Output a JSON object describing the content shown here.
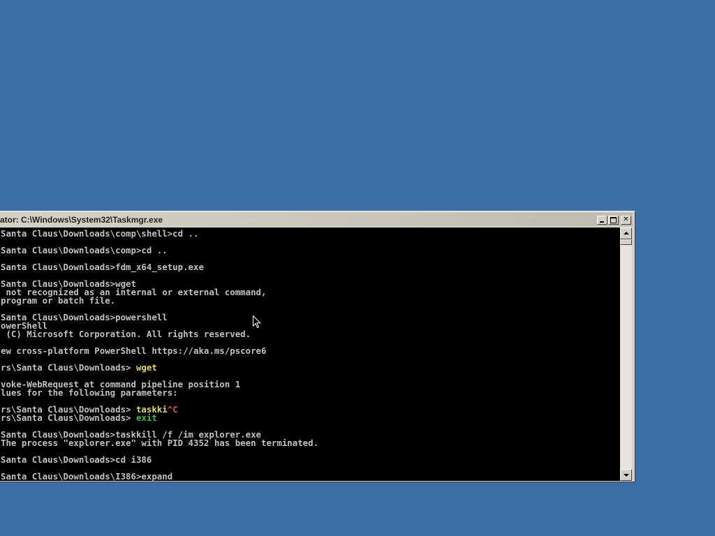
{
  "window": {
    "title": "ator: C:\\Windows\\System32\\Taskmgr.exe"
  },
  "console": {
    "lines": [
      [
        {
          "t": "Santa Claus\\Downloads\\comp\\shell>cd ..",
          "c": ""
        }
      ],
      [
        {
          "t": "",
          "c": ""
        }
      ],
      [
        {
          "t": "Santa Claus\\Downloads\\comp>cd ..",
          "c": ""
        }
      ],
      [
        {
          "t": "",
          "c": ""
        }
      ],
      [
        {
          "t": "Santa Claus\\Downloads>fdm_x64_setup.exe",
          "c": ""
        }
      ],
      [
        {
          "t": "",
          "c": ""
        }
      ],
      [
        {
          "t": "Santa Claus\\Downloads>wget",
          "c": ""
        }
      ],
      [
        {
          "t": " not recognized as an internal or external command,",
          "c": ""
        }
      ],
      [
        {
          "t": "program or batch file.",
          "c": ""
        }
      ],
      [
        {
          "t": "",
          "c": ""
        }
      ],
      [
        {
          "t": "Santa Claus\\Downloads>powershell",
          "c": ""
        }
      ],
      [
        {
          "t": "owerShell",
          "c": ""
        }
      ],
      [
        {
          "t": " (C) Microsoft Corporation. All rights reserved.",
          "c": ""
        }
      ],
      [
        {
          "t": "",
          "c": ""
        }
      ],
      [
        {
          "t": "ew cross-platform PowerShell https://aka.ms/pscore6",
          "c": ""
        }
      ],
      [
        {
          "t": "",
          "c": ""
        }
      ],
      [
        {
          "t": "rs\\Santa Claus\\Downloads> ",
          "c": ""
        },
        {
          "t": "wget",
          "c": "t-yellow"
        }
      ],
      [
        {
          "t": "",
          "c": ""
        }
      ],
      [
        {
          "t": "voke-WebRequest at command pipeline position 1",
          "c": ""
        }
      ],
      [
        {
          "t": "lues for the following parameters:",
          "c": ""
        }
      ],
      [
        {
          "t": "",
          "c": ""
        }
      ],
      [
        {
          "t": "rs\\Santa Claus\\Downloads> ",
          "c": ""
        },
        {
          "t": "taskki",
          "c": "t-yellow"
        },
        {
          "t": "^C",
          "c": "t-red"
        }
      ],
      [
        {
          "t": "rs\\Santa Claus\\Downloads> ",
          "c": ""
        },
        {
          "t": "exit",
          "c": "t-green"
        }
      ],
      [
        {
          "t": "",
          "c": ""
        }
      ],
      [
        {
          "t": "Santa Claus\\Downloads>taskkill /f /im explorer.exe",
          "c": ""
        }
      ],
      [
        {
          "t": "The process \"explorer.exe\" with PID 4352 has been terminated.",
          "c": ""
        }
      ],
      [
        {
          "t": "",
          "c": ""
        }
      ],
      [
        {
          "t": "Santa Claus\\Downloads>cd i386",
          "c": ""
        }
      ],
      [
        {
          "t": "",
          "c": ""
        }
      ],
      [
        {
          "t": "Santa Claus\\Downloads\\I386>expand",
          "c": ""
        }
      ]
    ]
  },
  "colors": {
    "desktop": "#3a6ea5",
    "console_bg": "#000000",
    "console_fg": "#c0c0c0",
    "frame": "#d4d0c8"
  },
  "icons": {
    "minimize": "minimize-icon",
    "maximize": "maximize-icon",
    "close": "close-icon",
    "scroll_up": "chevron-up-icon",
    "scroll_down": "chevron-down-icon",
    "pointer": "mouse-pointer-icon"
  }
}
